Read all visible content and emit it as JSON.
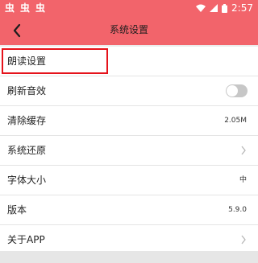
{
  "colors": {
    "header": "#f2646b",
    "highlight_box": "#e5131b",
    "toggle_off": "#c7c7c7"
  },
  "status_bar": {
    "left_icons": [
      "app-notification-icon",
      "app-notification-icon",
      "app-notification-icon"
    ],
    "time": "2:57",
    "right_icons": [
      "wifi-icon",
      "cellular-signal-icon",
      "battery-icon"
    ]
  },
  "header": {
    "title": "系统设置",
    "back_icon": "chevron-left-icon"
  },
  "settings": [
    {
      "label": "朗读设置",
      "type": "link",
      "highlighted": true
    },
    {
      "label": "刷新音效",
      "type": "toggle",
      "state": "off"
    },
    {
      "label": "清除缓存",
      "type": "value",
      "value": "2.05M"
    },
    {
      "label": "系统还原",
      "type": "link"
    },
    {
      "label": "字体大小",
      "type": "value",
      "value": "中"
    },
    {
      "label": "版本",
      "type": "value",
      "value": "5.9.0"
    },
    {
      "label": "关于APP",
      "type": "link"
    }
  ]
}
